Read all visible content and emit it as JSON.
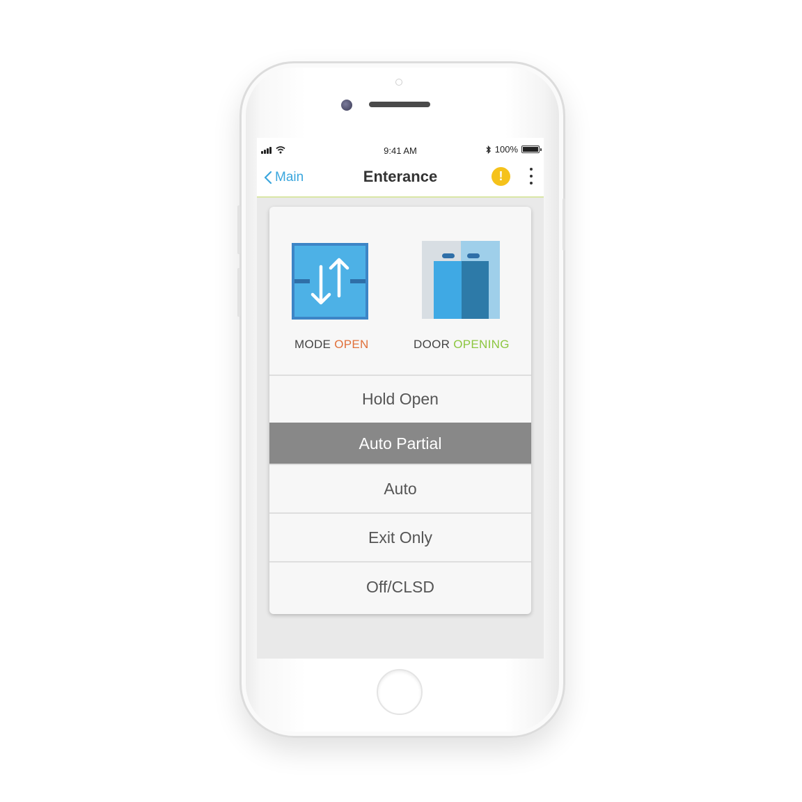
{
  "status_bar": {
    "time": "9:41 AM",
    "battery_text": "100%",
    "icons": [
      "signal-icon",
      "wifi-icon",
      "bluetooth-icon",
      "battery-icon"
    ]
  },
  "nav": {
    "back_label": "Main",
    "title": "Enterance",
    "alert_symbol": "!",
    "icons": [
      "chevron-left-icon",
      "alert-icon",
      "more-vertical-icon"
    ]
  },
  "status": {
    "mode": {
      "label": "MODE",
      "value": "OPEN",
      "icon": "bidirectional-arrows-icon"
    },
    "door": {
      "label": "DOOR",
      "value": "OPENING",
      "icon": "sliding-door-icon"
    }
  },
  "modes": [
    {
      "label": "Hold Open",
      "selected": false
    },
    {
      "label": "Auto Partial",
      "selected": true
    },
    {
      "label": "Auto",
      "selected": false
    },
    {
      "label": "Exit Only",
      "selected": false
    },
    {
      "label": "Off/CLSD",
      "selected": false
    }
  ],
  "colors": {
    "accent_blue": "#3aa6dd",
    "mode_value": "#e0703a",
    "door_value": "#8cc63f",
    "alert": "#f5c21b",
    "selected_bg": "#888888"
  }
}
